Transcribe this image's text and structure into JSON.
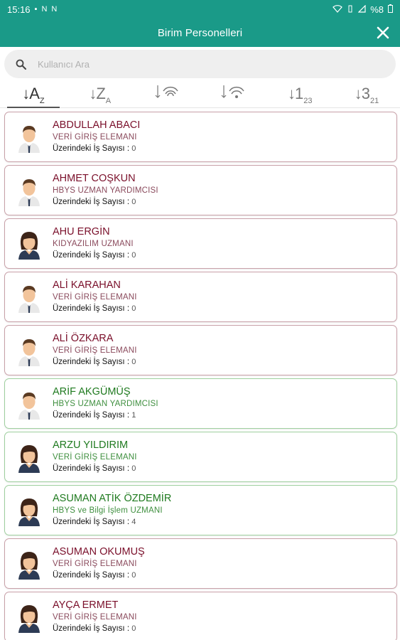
{
  "status_bar": {
    "time": "15:16",
    "battery": "%8"
  },
  "header": {
    "title": "Birim Personelleri"
  },
  "search": {
    "placeholder": "Kullanıcı Ara"
  },
  "sort_tabs": [
    {
      "icon": "sort-alpha-asc-icon",
      "glyph": "↓A",
      "sub": "Z",
      "active": true
    },
    {
      "icon": "sort-alpha-desc-icon",
      "glyph": "↓Z",
      "sub": "A"
    },
    {
      "icon": "sort-signal-strong-icon",
      "glyph": "↓",
      "sub": ""
    },
    {
      "icon": "sort-signal-weak-icon",
      "glyph": "↓",
      "sub": ""
    },
    {
      "icon": "sort-numeric-asc-icon",
      "glyph": "↓1",
      "sub": "23"
    },
    {
      "icon": "sort-numeric-desc-icon",
      "glyph": "↓3",
      "sub": "21"
    }
  ],
  "count_label": "Üzerindeki İş Sayısı :",
  "colors": {
    "primary": "#1a9a88",
    "name_default": "#7a0f2a",
    "name_active": "#1f7a1f"
  },
  "personnel": [
    {
      "name": "ABDULLAH ABACI",
      "role": "VERİ GİRİŞ ELEMANI",
      "count": "0",
      "gender": "male",
      "status": "default"
    },
    {
      "name": "AHMET COŞKUN",
      "role": "HBYS UZMAN YARDIMCISI",
      "count": "0",
      "gender": "male",
      "status": "default"
    },
    {
      "name": "AHU ERGİN",
      "role": "KIDYAZILIM UZMANI",
      "count": "0",
      "gender": "female",
      "status": "default"
    },
    {
      "name": "ALİ KARAHAN",
      "role": "VERİ GİRİŞ ELEMANI",
      "count": "0",
      "gender": "male",
      "status": "default"
    },
    {
      "name": "ALİ ÖZKARA",
      "role": "VERİ GİRİŞ ELEMANI",
      "count": "0",
      "gender": "male",
      "status": "default"
    },
    {
      "name": "ARİF AKGÜMÜŞ",
      "role": "HBYS UZMAN YARDIMCISI",
      "count": "1",
      "gender": "male",
      "status": "green"
    },
    {
      "name": "ARZU YILDIRIM",
      "role": "VERİ GİRİŞ ELEMANI",
      "count": "0",
      "gender": "female",
      "status": "green"
    },
    {
      "name": "ASUMAN ATİK ÖZDEMİR",
      "role": "HBYS ve Bilgi İşlem UZMANI",
      "count": "4",
      "gender": "female",
      "status": "green"
    },
    {
      "name": "ASUMAN OKUMUŞ",
      "role": "VERİ GİRİŞ ELEMANI",
      "count": "0",
      "gender": "female",
      "status": "default"
    },
    {
      "name": "AYÇA ERMET",
      "role": "VERİ GİRİŞ ELEMANI",
      "count": "0",
      "gender": "female",
      "status": "default"
    }
  ]
}
